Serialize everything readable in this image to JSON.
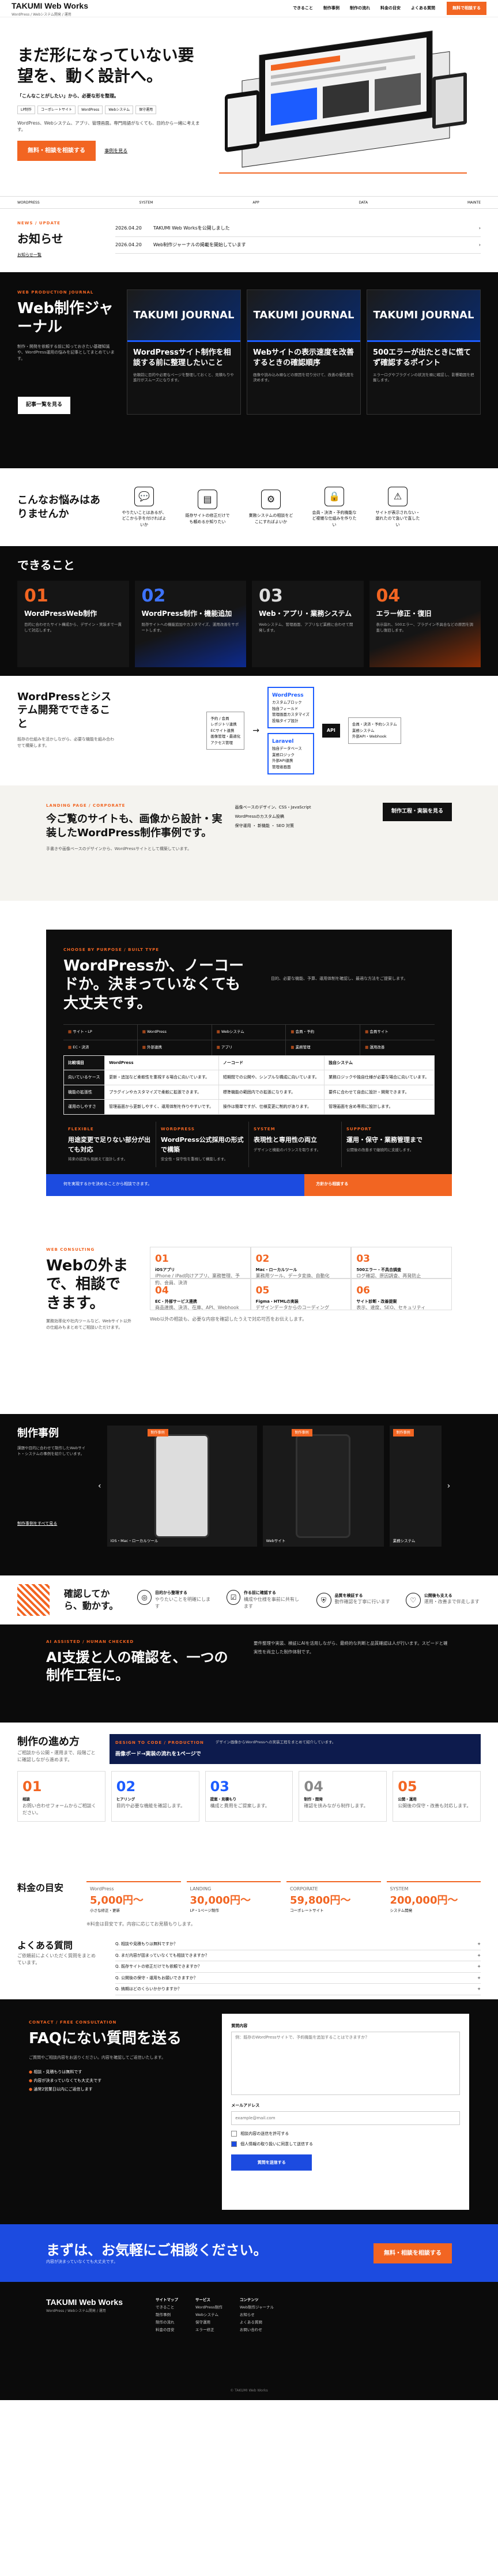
{
  "header": {
    "logo": "TAKUMI Web Works",
    "logo_sub": "WordPress / Webシステム開発 / 運用",
    "nav": [
      "できること",
      "制作事例",
      "制作の流れ",
      "料金の目安",
      "よくある質問"
    ],
    "cta": "無料で相談する"
  },
  "hero": {
    "title": "まだ形になっていない要望を、動く設計へ。",
    "lead": "「こんなことがしたい」から、必要な形を整理。",
    "tags": [
      "LP制作",
      "コーポレートサイト",
      "WordPress",
      "Webシステム",
      "保守運用"
    ],
    "body": "WordPress、Webシステム、アプリ、管理画面。専門用語がなくても、目的から一緒に考えます。",
    "cta": "無料・相談を相談する",
    "cta_alt": "事例を見る",
    "bar": [
      "WORDPRESS",
      "SYSTEM",
      "APP",
      "DATA",
      "MAINTE"
    ]
  },
  "news": {
    "kicker": "NEWS / UPDATE",
    "title": "お知らせ",
    "more": "お知らせ一覧",
    "items": [
      {
        "date": "2026.04.20",
        "text": "TAKUMI Web Worksを公開しました"
      },
      {
        "date": "2026.04.20",
        "text": "Web制作ジャーナルの掲載を開始しています"
      }
    ]
  },
  "journal": {
    "kicker": "WEB PRODUCTION JOURNAL",
    "title": "Web制作ジャーナル",
    "body": "制作・開発を依頼する前に知っておきたい基礎知識や、WordPress運用の悩みを記事としてまとめています。",
    "more": "記事一覧を見る",
    "cards": [
      {
        "img": "TAKUMI JOURNAL",
        "title": "WordPressサイト制作を相談する前に整理したいこと",
        "text": "依頼前に目的や必要なページを整理しておくと、見積もりや進行がスムーズになります。"
      },
      {
        "img": "TAKUMI JOURNAL",
        "title": "Webサイトの表示速度を改善するときの確認順序",
        "text": "画像や読み込み順などの原因を切り分けて、改善の優先度を決めます。"
      },
      {
        "img": "TAKUMI JOURNAL",
        "title": "500エラーが出たときに慌てず確認するポイント",
        "text": "エラーログやプラグインの状況を順に確認し、影響範囲を把握します。"
      }
    ]
  },
  "worry": {
    "title": "こんなお悩みはありませんか",
    "items": [
      {
        "icon": "chat-icon",
        "text": "やりたいことはあるが、どこから手を付ければよいか"
      },
      {
        "icon": "doc-icon",
        "text": "既存サイトの修正だけでも頼めるか知りたい"
      },
      {
        "icon": "gear-icon",
        "text": "業務システムの相談をどこにすればよいか"
      },
      {
        "icon": "lock-icon",
        "text": "会員・決済・予約機能など複雑な仕組みを作りたい"
      },
      {
        "icon": "warning-icon",
        "text": "サイトが表示されない・崩れたので急いで直したい"
      }
    ]
  },
  "cando": {
    "title": "できること",
    "cards": [
      {
        "num": "01",
        "title": "WordPressWeb制作",
        "text": "目的に合わせたサイト構成から、デザイン・実装まで一貫して対応します。"
      },
      {
        "num": "02",
        "title": "WordPress制作・機能追加",
        "text": "既存サイトへの機能追加やカスタマイズ、運用改善をサポートします。"
      },
      {
        "num": "03",
        "title": "Web・アプリ・業務システム",
        "text": "Webシステム、管理画面、アプリなど業務に合わせて開発します。"
      },
      {
        "num": "04",
        "title": "エラー修正・復旧",
        "text": "表示崩れ、500エラー、プラグイン不具合などの原因を調査し復旧します。"
      }
    ]
  },
  "system": {
    "title": "WordPressとシステム開発でできること",
    "body": "既存の仕組みを活かしながら、必要な機能を組み合わせて構築します。",
    "left": [
      "予約 / 会員",
      "レポジトリ連携",
      "ECサイト連携",
      "画像管理・最適化",
      "アクセス管理"
    ],
    "center_title": "WordPress",
    "center": [
      "カスタムブロック",
      "独自フィールド",
      "管理画面カスタマイズ",
      "投稿タイプ設計"
    ],
    "laravel_title": "Laravel",
    "laravel": [
      "独自データベース",
      "業務ロジック",
      "外部API連携",
      "管理者画面"
    ],
    "api": "API",
    "right": [
      "会員・決済・予約システム",
      "業務システム",
      "外部API・Webhook"
    ]
  },
  "lightband": {
    "kicker": "LANDING PAGE / CORPORATE",
    "title": "今ご覧のサイトも、画像から設計・実装したWordPress制作事例です。",
    "body": "手書きや画像ベースのデザインから、WordPressサイトとして構築しています。",
    "points": [
      "画像ベースのデザイン、CSS・JavaScript",
      "WordPressのカスタム投稿",
      "保守運用 ・ 新機能 ・ SEO 対策"
    ],
    "cta": "制作工程・実装を見る"
  },
  "choice": {
    "kicker": "CHOOSE BY PURPOSE / BUILT TYPE",
    "title": "WordPressか、ノーコードか。決まっていなくても大丈夫です。",
    "body": "目的、必要な機能、予算、運用体制を確認し、最適な方法をご提案します。",
    "types": [
      "サイト・LP",
      "WordPress",
      "Webシステム",
      "会員・予約",
      "会員サイト",
      "EC・決済",
      "外部連携",
      "アプリ",
      "業務管理",
      "運用改善"
    ],
    "table_head": [
      "比較項目",
      "WordPress",
      "ノーコード",
      "独自システム"
    ],
    "rows": [
      {
        "label": "向いているケース",
        "cells": [
          "更新・追加など柔軟性を重視する場合に向いています。",
          "短期間での公開や、シンプルな構成に向いています。",
          "業務ロジックや独自仕様が必要な場合に向いています。"
        ]
      },
      {
        "label": "機能の拡張性",
        "cells": [
          "プラグインやカスタマイズで柔軟に拡張できます。",
          "標準機能の範囲内での拡張になります。",
          "要件に合わせて自由に設計・開発できます。"
        ]
      },
      {
        "label": "運用のしやすさ",
        "cells": [
          "管理画面から更新しやすく、運用体制を作りやすいです。",
          "操作は簡単ですが、仕様変更に制約があります。",
          "管理画面を含め専用に設計します。"
        ]
      }
    ],
    "features": [
      {
        "kicker": "FLEXIBLE",
        "title": "用途変更で足りない部分が出ても対応",
        "text": "将来の拡張も見据えて設計します。"
      },
      {
        "kicker": "WORDPRESS",
        "title": "WordPress公式採用の形式で構築",
        "text": "安全性・保守性を重視して構築します。"
      },
      {
        "kicker": "SYSTEM",
        "title": "表現性と専用性の両立",
        "text": "デザインと機能のバランスを取ります。"
      },
      {
        "kicker": "SUPPORT",
        "title": "運用・保守・業務管理まで",
        "text": "公開後の改善まで継続的に支援します。"
      }
    ],
    "note": "何を実現するかを決めることから相談できます。",
    "cta": "方針から相談する"
  },
  "webout": {
    "kicker": "WEB CONSULTING",
    "title": "Webの外まで、相談できます。",
    "body": "業務効率化や社内ツールなど、Webサイト以外の仕組みもまとめてご相談いただけます。",
    "cells": [
      {
        "num": "01",
        "title": "iOSアプリ",
        "text": "iPhone / iPad向けアプリ、業務管理、予約、会員、決済"
      },
      {
        "num": "02",
        "title": "Mac・ローカルツール",
        "text": "業務用ツール、データ変換、自動化"
      },
      {
        "num": "03",
        "title": "500エラー・不具合調査",
        "text": "ログ確認、原因調査、再発防止"
      },
      {
        "num": "04",
        "title": "EC・外部サービス連携",
        "text": "商品連携、決済、在庫、API、Webhook"
      },
      {
        "num": "05",
        "title": "Figma・HTMLの実装",
        "text": "デザインデータからのコーディング"
      },
      {
        "num": "06",
        "title": "サイト診断・改善提案",
        "text": "表示、速度、SEO、セキュリティ"
      }
    ],
    "note": "Web以外の相談も、必要な内容を確認したうえで対応可否をお伝えします。"
  },
  "works": {
    "title": "制作事例",
    "body": "課題や目的に合わせて制作したWebサイト・システムの事例を紹介しています。",
    "more": "制作事例をすべて見る",
    "items": [
      {
        "badge": "制作事例",
        "label": "iOS・Mac・ローカルツール"
      },
      {
        "badge": "制作事例",
        "label": "Webサイト"
      },
      {
        "badge": "制作事例",
        "label": "業務システム"
      }
    ]
  },
  "check": {
    "title": "確認してから、動かす。",
    "items": [
      {
        "title": "目的から整理する",
        "text": "やりたいことを明確にします"
      },
      {
        "title": "作る前に確認する",
        "text": "構成や仕様を事前に共有します"
      },
      {
        "title": "品質を検証する",
        "text": "動作確認を丁寧に行います"
      },
      {
        "title": "公開後も支える",
        "text": "運用・改善まで伴走します"
      }
    ]
  },
  "ai": {
    "kicker": "AI ASSISTED / HUMAN CHECKED",
    "title": "AI支援と人の確認を、一つの制作工程に。",
    "body": "要件整理や実装、検証にAIを活用しながら、最終的な判断と品質確認は人が行います。スピードと確実性を両立した制作体制です。"
  },
  "flow": {
    "title": "制作の進め方",
    "body": "ご相談から公開・運用まで、段階ごとに確認しながら進めます。",
    "banner_kicker": "DESIGN TO CODE / PRODUCTION",
    "banner": "画像ボード→実装の流れを1ページで",
    "banner_text": "デザイン画像からWordPressへの実装工程をまとめて紹介しています。",
    "steps": [
      {
        "num": "01",
        "title": "相談",
        "text": "お問い合わせフォームからご相談ください。"
      },
      {
        "num": "02",
        "title": "ヒアリング",
        "text": "目的や必要な機能を確認します。"
      },
      {
        "num": "03",
        "title": "提案・見積もり",
        "text": "構成と費用をご提案します。"
      },
      {
        "num": "04",
        "title": "制作・開発",
        "text": "確認を挟みながら制作します。"
      },
      {
        "num": "05",
        "title": "公開・運用",
        "text": "公開後の保守・改善も対応します。"
      }
    ]
  },
  "price": {
    "title": "料金の目安",
    "items": [
      {
        "label": "WordPress",
        "value": "5,000円〜",
        "text": "小さな修正・更新"
      },
      {
        "label": "LANDING",
        "value": "30,000円〜",
        "text": "LP・1ページ制作"
      },
      {
        "label": "CORPORATE",
        "value": "59,800円〜",
        "text": "コーポレートサイト"
      },
      {
        "label": "SYSTEM",
        "value": "200,000円〜",
        "text": "システム開発"
      }
    ],
    "note": "※料金は目安です。内容に応じてお見積もりします。"
  },
  "faq": {
    "title": "よくある質問",
    "body": "ご依頼前によくいただく質問をまとめています。",
    "items": [
      "Q. 相談や見積もりは無料ですか？",
      "Q. まだ内容が固まっていなくても相談できますか？",
      "Q. 既存サイトの修正だけでも依頼できますか？",
      "Q. 公開後の保守・運用もお願いできますか？",
      "Q. 納期はどのくらいかかりますか？"
    ]
  },
  "form": {
    "kicker": "CONTACT / FREE CONSULTATION",
    "title": "FAQにない質問を送る",
    "body": "ご質問やご相談内容をお送りください。内容を確認してご返信いたします。",
    "points": [
      "相談・見積もりは無料です",
      "内容が決まっていなくても大丈夫です",
      "通常2営業日以内にご返信します"
    ],
    "q_label": "質問内容",
    "q_placeholder": "例：既存のWordPressサイトで、予約機能を追加することはできますか？",
    "mail_label": "メールアドレス",
    "mail_placeholder": "example@mail.com",
    "check1": "相談内容の送信を許可する",
    "check2": "個人情報の取り扱いに同意して送信する",
    "submit": "質問を送信する"
  },
  "cta": {
    "title": "まずは、お気軽にご相談ください。",
    "text": "内容が決まっていなくても大丈夫です。",
    "button": "無料・相談を相談する"
  },
  "footer": {
    "logo": "TAKUMI Web Works",
    "sub": "WordPress / Webシステム開発 / 運用",
    "cols": [
      {
        "head": "サイトマップ",
        "items": [
          "できること",
          "制作事例",
          "制作の流れ",
          "料金の目安"
        ]
      },
      {
        "head": "サービス",
        "items": [
          "WordPress制作",
          "Webシステム",
          "保守運用",
          "エラー修正"
        ]
      },
      {
        "head": "コンテンツ",
        "items": [
          "Web制作ジャーナル",
          "お知らせ",
          "よくある質問",
          "お問い合わせ"
        ]
      }
    ],
    "copy": "© TAKUMI Web Works"
  }
}
